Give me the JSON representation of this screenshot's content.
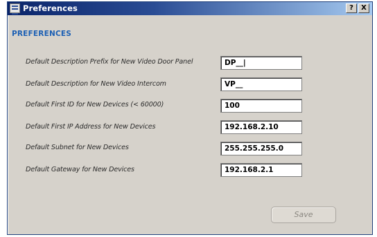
{
  "window": {
    "title": "Preferences",
    "help_label": "?",
    "close_label": "X"
  },
  "section": {
    "heading": "PREFERENCES"
  },
  "fields": [
    {
      "label": "Default Description Prefix for New Video Door Panel",
      "value": "DP__|"
    },
    {
      "label": "Default Description for New Video Intercom",
      "value": "VP__"
    },
    {
      "label": "Default First ID for New Devices (< 60000)",
      "value": "100"
    },
    {
      "label": "Default First IP Address for New Devices",
      "value": "192.168.2.10"
    },
    {
      "label": "Default Subnet for New Devices",
      "value": "255.255.255.0"
    },
    {
      "label": "Default Gateway for New Devices",
      "value": "192.168.2.1"
    }
  ],
  "actions": {
    "save_label": "Save"
  }
}
